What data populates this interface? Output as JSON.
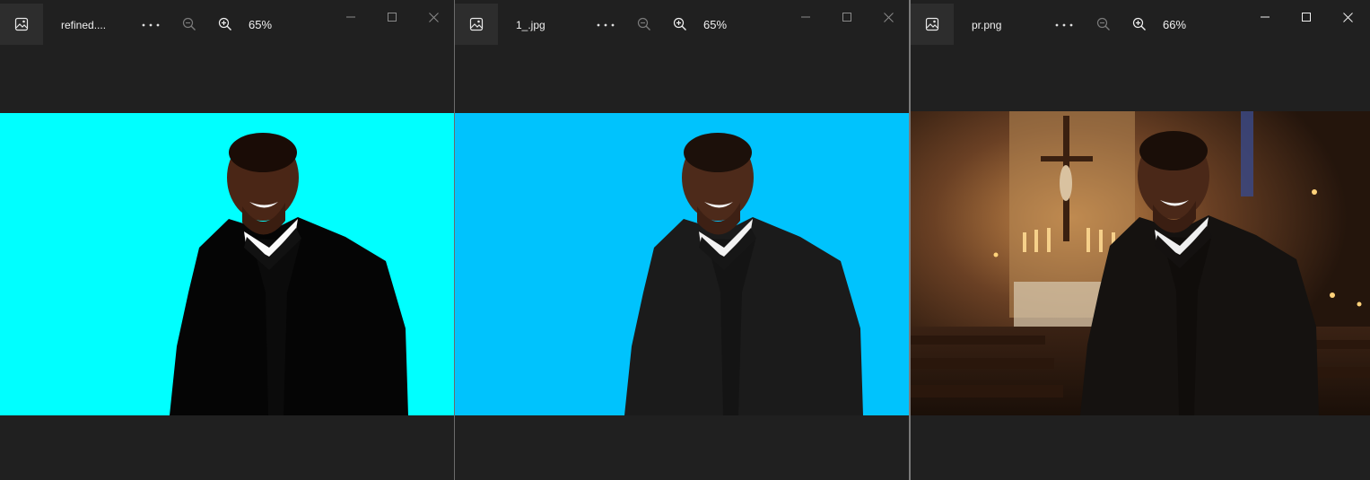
{
  "windows": [
    {
      "file_name": "refined....",
      "zoom": "65%",
      "photo_background": "#00ffff"
    },
    {
      "file_name": "1_.jpg",
      "zoom": "65%",
      "photo_background": "#00c3fd"
    },
    {
      "file_name": "pr.png",
      "zoom": "66%",
      "photo_background": "church-interior"
    }
  ],
  "icons": {
    "app": "photo-icon",
    "more": "more-options-icon",
    "zoom_out": "zoom-out-icon",
    "zoom_in": "zoom-in-icon",
    "minimize": "minimize-icon",
    "maximize": "maximize-icon",
    "close": "close-icon"
  },
  "colors": {
    "window_bg": "#202020",
    "text": "#f0f0f0",
    "cyan_bg": "#00ffff",
    "sky_bg": "#00c3fd"
  }
}
